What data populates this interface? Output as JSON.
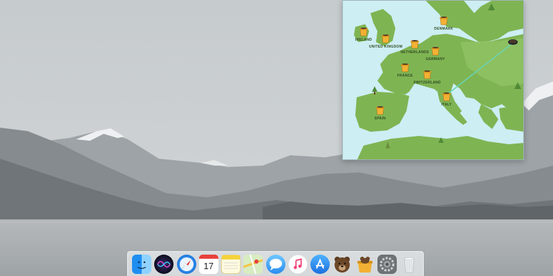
{
  "colors": {
    "sky": "#c9cdd0",
    "sea_map": "#cdeef3",
    "land_map": "#7fb453",
    "land_map_light": "#93c466",
    "tunnel_line": "#69d4b4",
    "lake": "#a9aeb2",
    "mountain": "#8f9598"
  },
  "map": {
    "countries": [
      {
        "label": "IRELAND",
        "icon": "honey-pot-icon"
      },
      {
        "label": "UNITED KINGDOM",
        "icon": "honey-pot-icon"
      },
      {
        "label": "DENMARK",
        "icon": "honey-pot-icon"
      },
      {
        "label": "NETHERLANDS",
        "icon": "honey-pot-icon"
      },
      {
        "label": "GERMANY",
        "icon": "honey-pot-icon"
      },
      {
        "label": "FRANCE",
        "icon": "honey-pot-icon"
      },
      {
        "label": "SWITZERLAND",
        "icon": "honey-pot-icon"
      },
      {
        "label": "ITALY",
        "icon": "honey-pot-icon"
      },
      {
        "label": "SPAIN",
        "icon": "honey-pot-icon"
      }
    ]
  },
  "dock": {
    "apps": [
      {
        "name": "finder",
        "icon": "finder-icon"
      },
      {
        "name": "siri",
        "icon": "siri-icon"
      },
      {
        "name": "safari",
        "icon": "safari-icon"
      },
      {
        "name": "calendar",
        "icon": "calendar-icon",
        "day": "17"
      },
      {
        "name": "notes",
        "icon": "notes-icon"
      },
      {
        "name": "maps",
        "icon": "maps-icon"
      },
      {
        "name": "messages",
        "icon": "messages-icon"
      },
      {
        "name": "music",
        "icon": "music-icon"
      },
      {
        "name": "app-store",
        "icon": "app-store-icon"
      },
      {
        "name": "tunnelbear",
        "icon": "tunnelbear-icon"
      },
      {
        "name": "tunnelbear-alt",
        "icon": "bear-honey-icon"
      },
      {
        "name": "system-preferences",
        "icon": "gear-icon"
      },
      {
        "name": "trash",
        "icon": "trash-icon"
      }
    ]
  }
}
